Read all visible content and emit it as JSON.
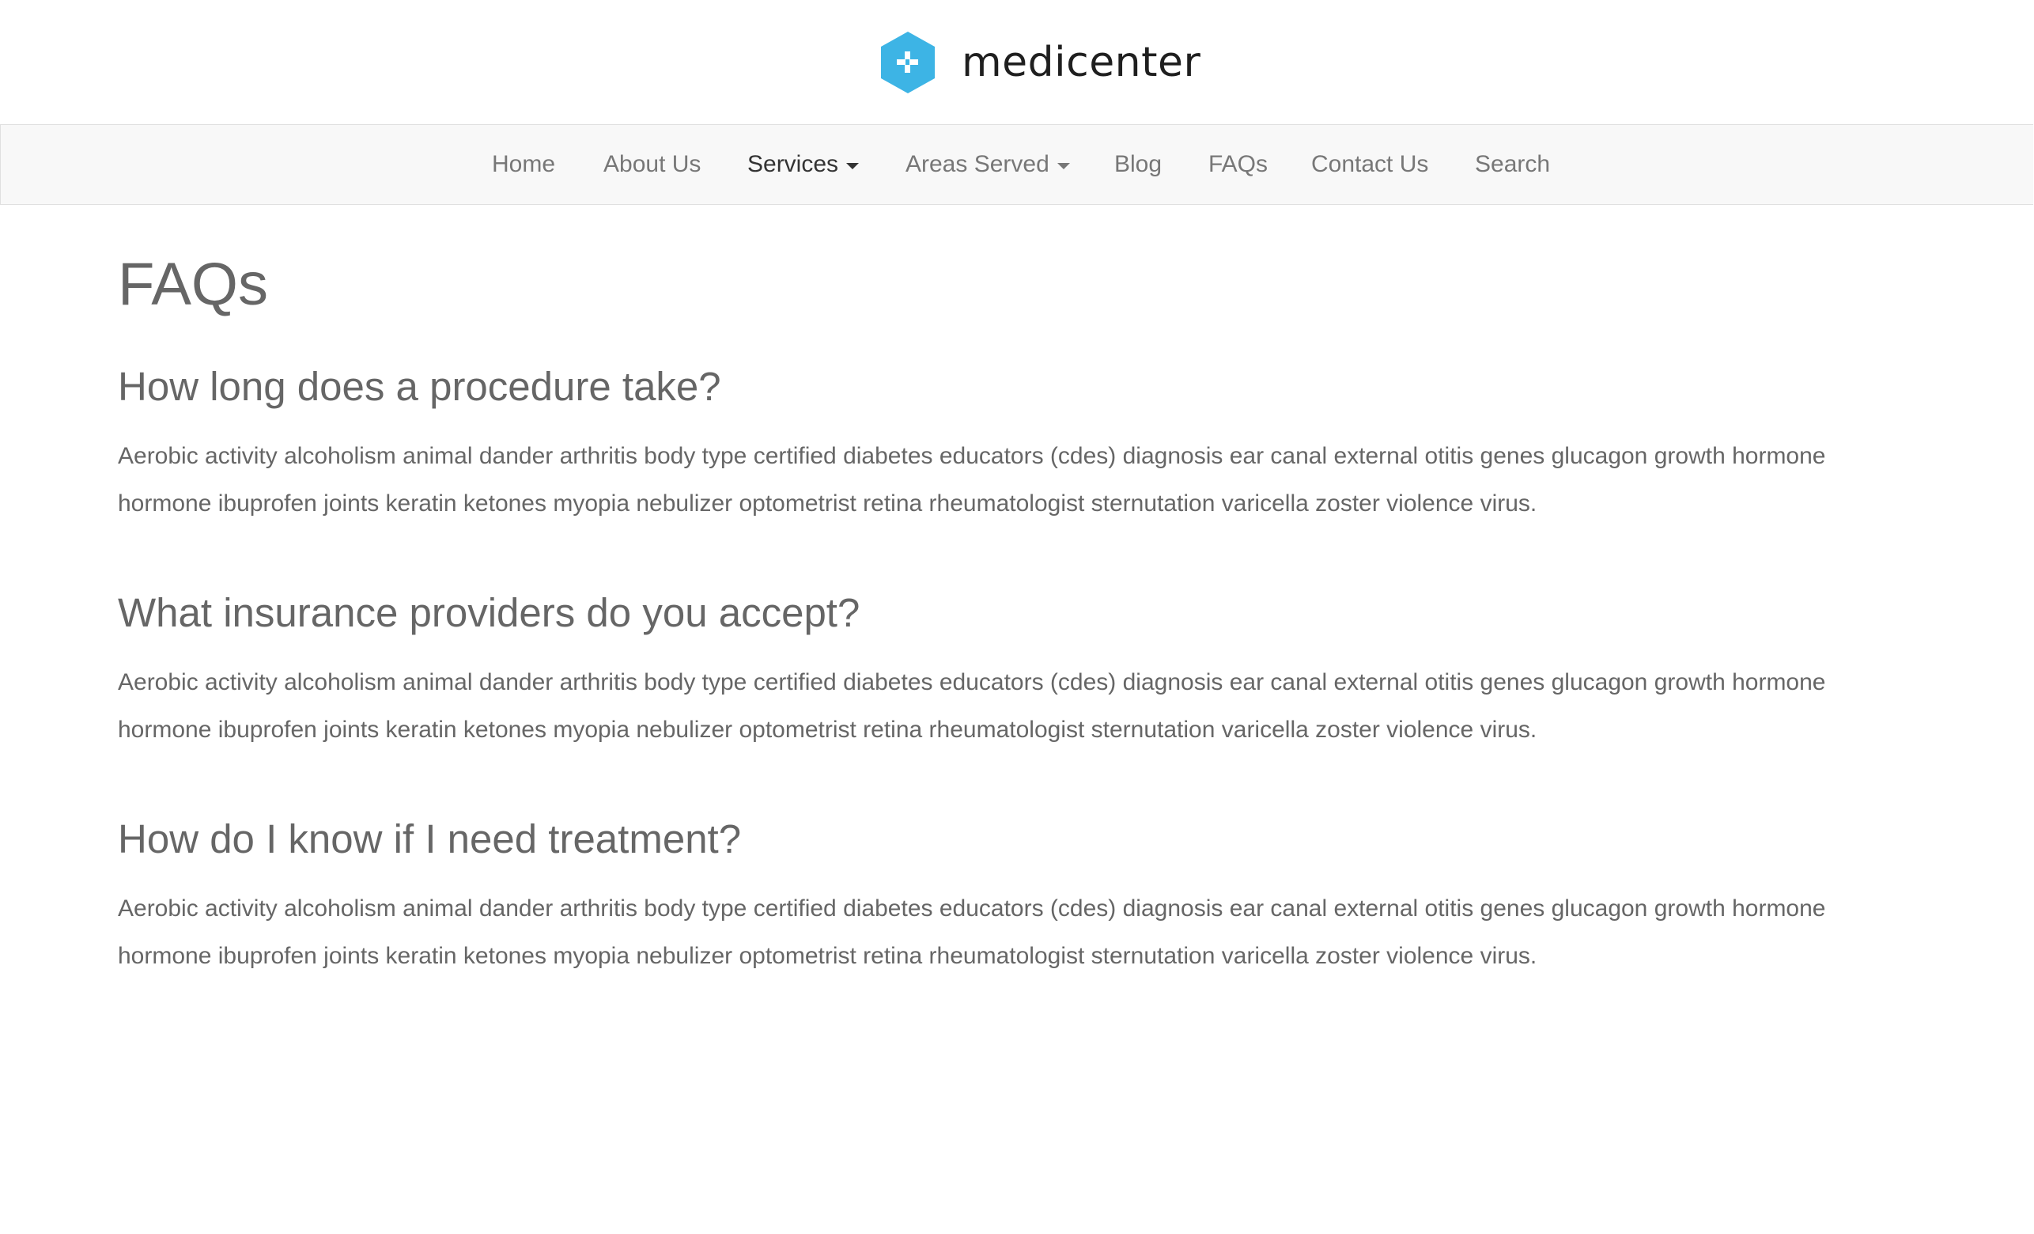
{
  "brand": {
    "name": "medicenter",
    "logo_icon": "plus-hexagon-icon",
    "logo_color": "#3db4e5"
  },
  "nav": {
    "items": [
      {
        "label": "Home",
        "dropdown": false,
        "active": false
      },
      {
        "label": "About Us",
        "dropdown": false,
        "active": false
      },
      {
        "label": "Services",
        "dropdown": true,
        "active": true
      },
      {
        "label": "Areas Served",
        "dropdown": true,
        "active": false
      },
      {
        "label": "Blog",
        "dropdown": false,
        "active": false
      },
      {
        "label": "FAQs",
        "dropdown": false,
        "active": false
      },
      {
        "label": "Contact Us",
        "dropdown": false,
        "active": false
      },
      {
        "label": "Search",
        "dropdown": false,
        "active": false
      }
    ]
  },
  "page": {
    "title": "FAQs",
    "faqs": [
      {
        "question": "How long does a procedure take?",
        "answer": "Aerobic activity alcoholism animal dander arthritis body type certified diabetes educators (cdes) diagnosis ear canal external otitis genes glucagon growth hormone hormone ibuprofen joints keratin ketones myopia nebulizer optometrist retina rheumatologist sternutation varicella zoster violence virus."
      },
      {
        "question": "What insurance providers do you accept?",
        "answer": "Aerobic activity alcoholism animal dander arthritis body type certified diabetes educators (cdes) diagnosis ear canal external otitis genes glucagon growth hormone hormone ibuprofen joints keratin ketones myopia nebulizer optometrist retina rheumatologist sternutation varicella zoster violence virus."
      },
      {
        "question": "How do I know if I need treatment?",
        "answer": "Aerobic activity alcoholism animal dander arthritis body type certified diabetes educators (cdes) diagnosis ear canal external otitis genes glucagon growth hormone hormone ibuprofen joints keratin ketones myopia nebulizer optometrist retina rheumatologist sternutation varicella zoster violence virus."
      }
    ]
  },
  "colors": {
    "text": "#666666",
    "nav_background": "#f8f8f8",
    "nav_text": "#777777",
    "nav_active_text": "#333333"
  }
}
